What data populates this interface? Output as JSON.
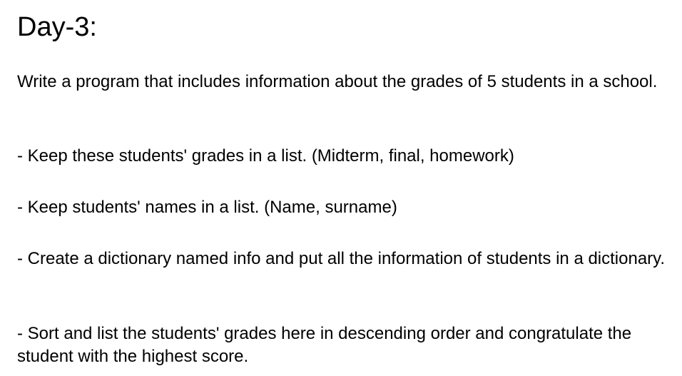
{
  "document": {
    "title": "Day-3:",
    "paragraphs": [
      "Write a program that includes information about the grades of 5 students in a school.",
      "- Keep these students' grades in a list. (Midterm, final, homework)",
      "- Keep students' names in a list. (Name, surname)",
      "- Create a dictionary named info and put all the information of students in a dictionary.",
      "- Sort and list the students' grades here in descending order and congratulate the student with the highest score."
    ]
  }
}
